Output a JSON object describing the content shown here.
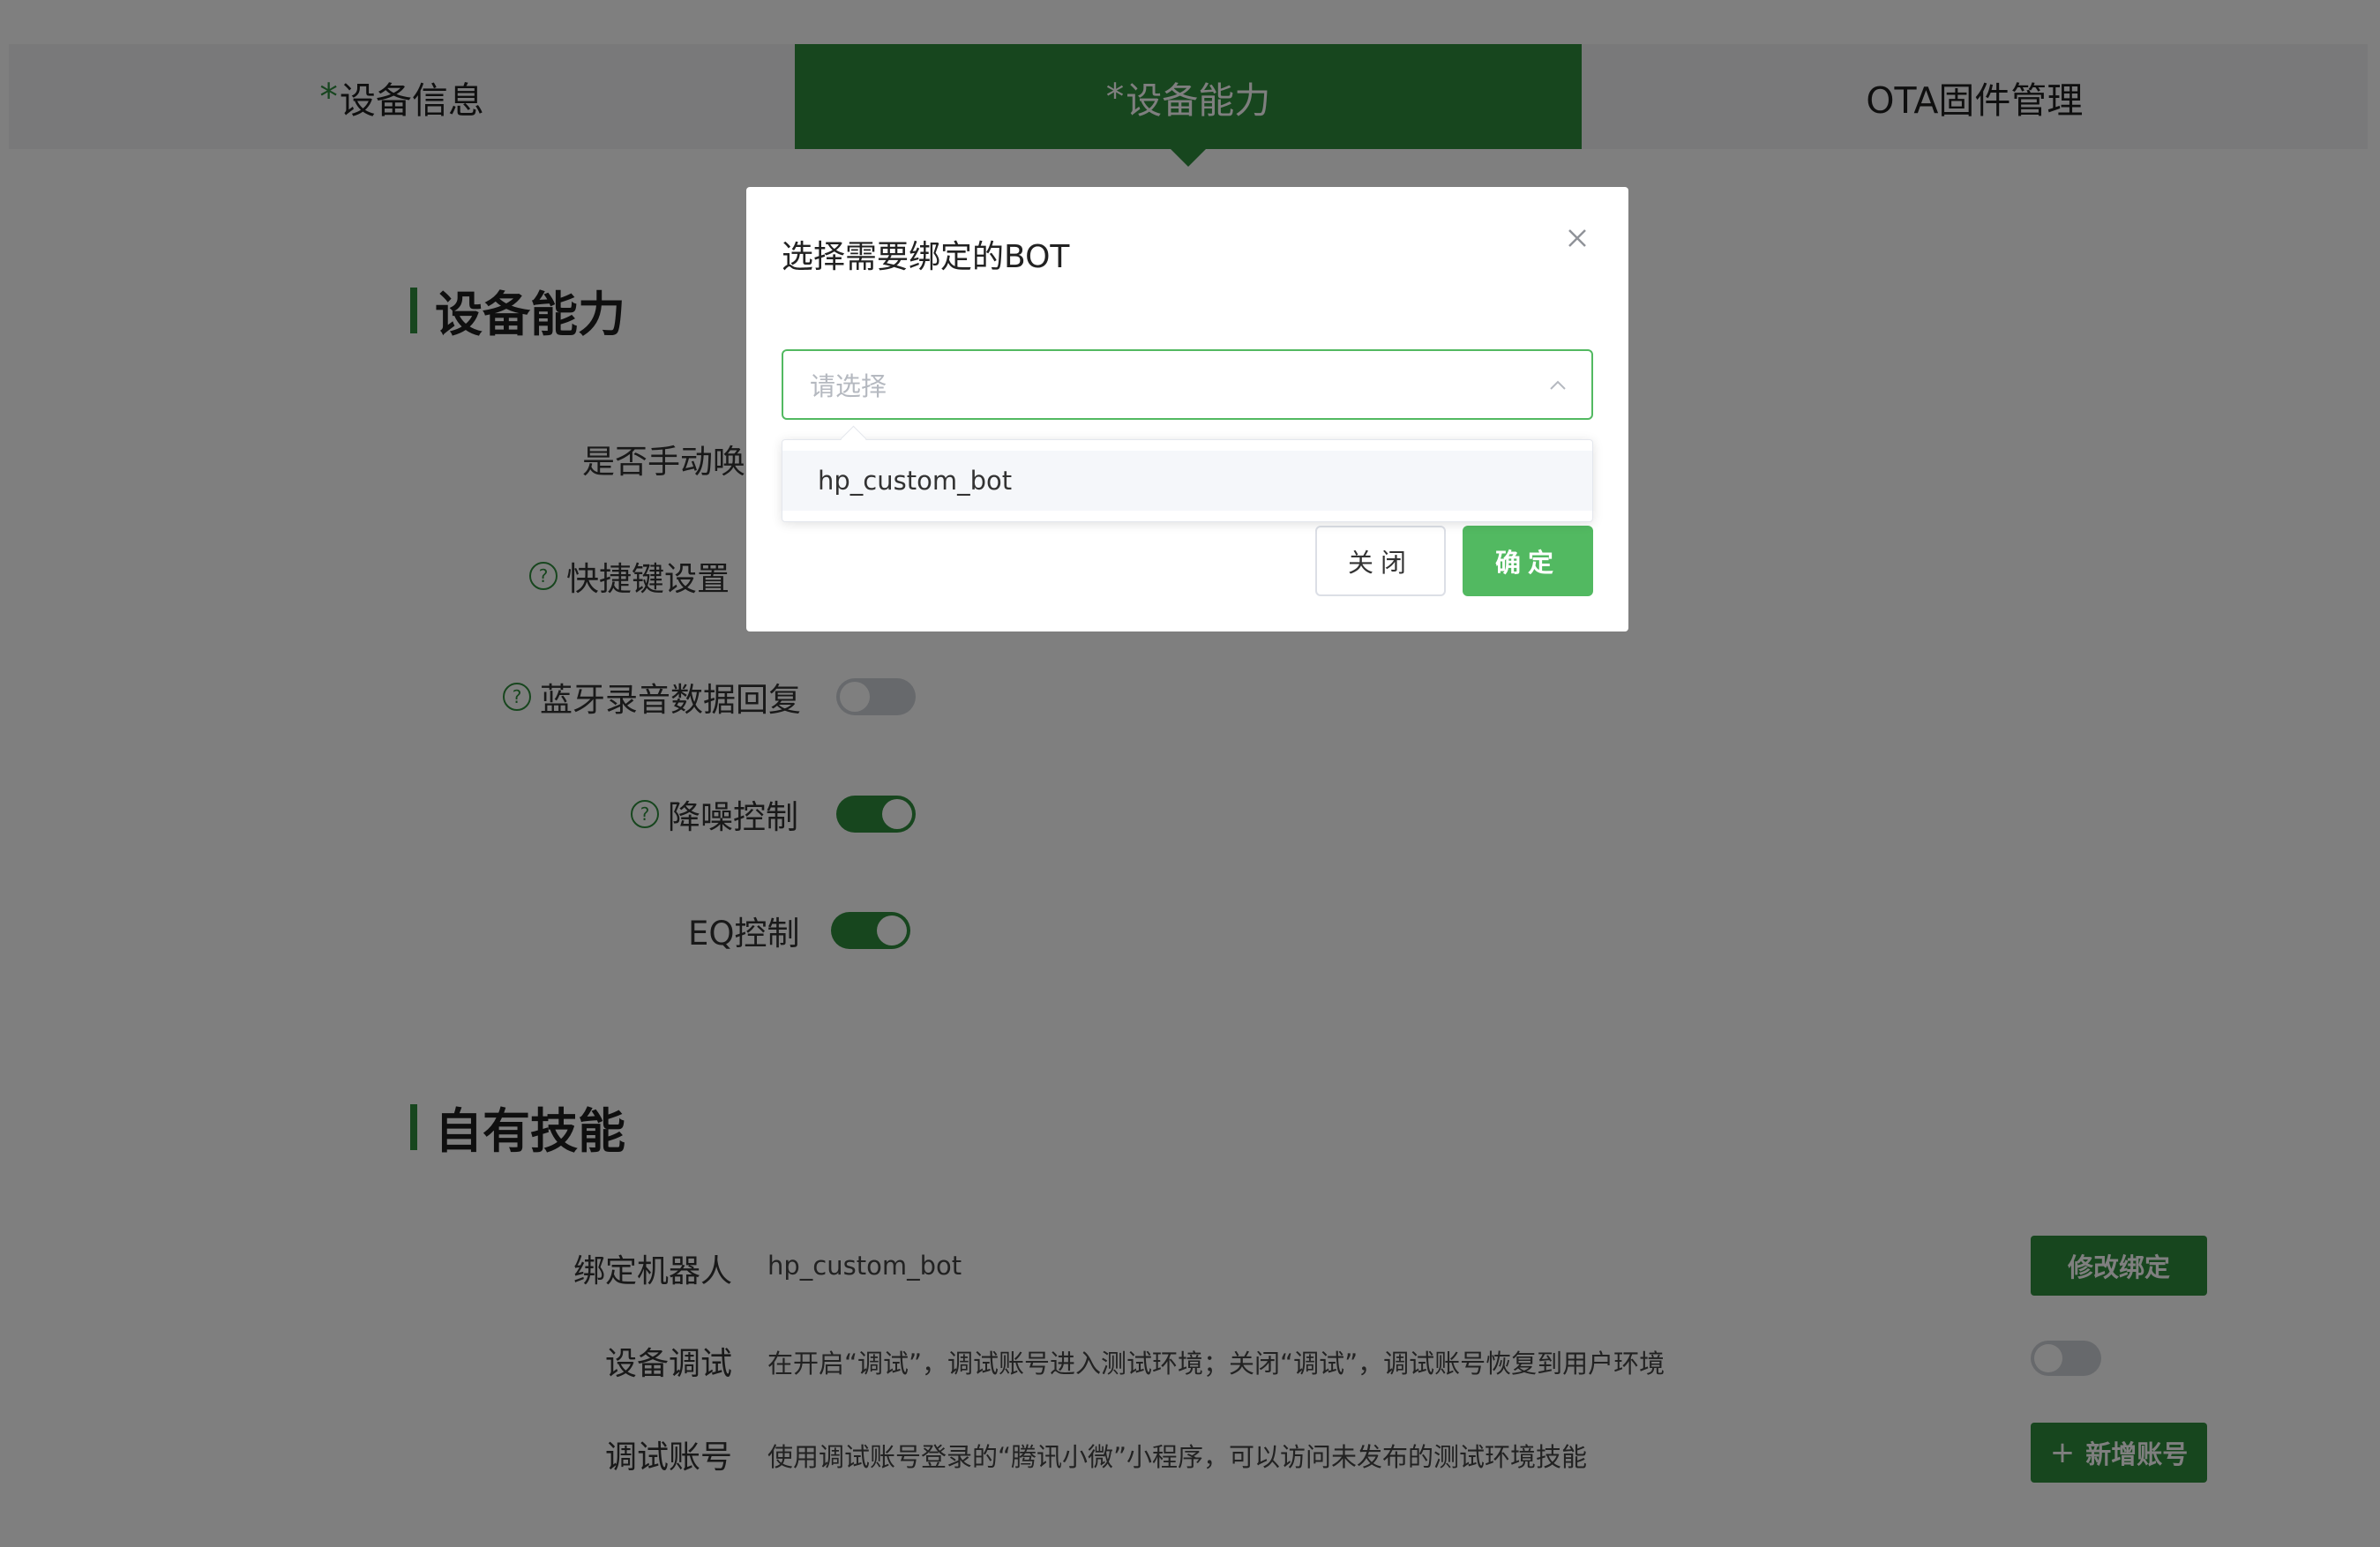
{
  "tabs": [
    {
      "label": "设备信息",
      "required": true,
      "active": false
    },
    {
      "label": "设备能力",
      "required": true,
      "active": true
    },
    {
      "label": "OTA固件管理",
      "required": false,
      "active": false
    }
  ],
  "sections": {
    "capability_title": "设备能力",
    "skills_title": "自有技能"
  },
  "capabilities": [
    {
      "label": "是否手动唤醒",
      "help": false
    },
    {
      "label": "快捷键设置",
      "help": true
    },
    {
      "label": "蓝牙录音数据回复",
      "help": true,
      "on": false
    },
    {
      "label": "降噪控制",
      "help": true,
      "on": true
    },
    {
      "label": "EQ控制",
      "help": false,
      "on": true
    }
  ],
  "skills": {
    "bot_label": "绑定机器人",
    "bot_value": "hp_custom_bot",
    "modify_button": "修改绑定",
    "debug_label": "设备调试",
    "debug_desc": "在开启“调试”，调试账号进入测试环境；关闭“调试”，调试账号恢复到用户环境",
    "debug_on": false,
    "account_label": "调试账号",
    "account_desc": "使用调试账号登录的“腾讯小微”小程序，可以访问未发布的测试环境技能",
    "add_account_button": "新增账号"
  },
  "modal": {
    "title": "选择需要绑定的BOT",
    "select_placeholder": "请选择",
    "options": [
      "hp_custom_bot"
    ],
    "close_button": "关闭",
    "ok_button": "确定"
  },
  "colors": {
    "accent": "#2f8c3c",
    "accent_light": "#52b961"
  }
}
